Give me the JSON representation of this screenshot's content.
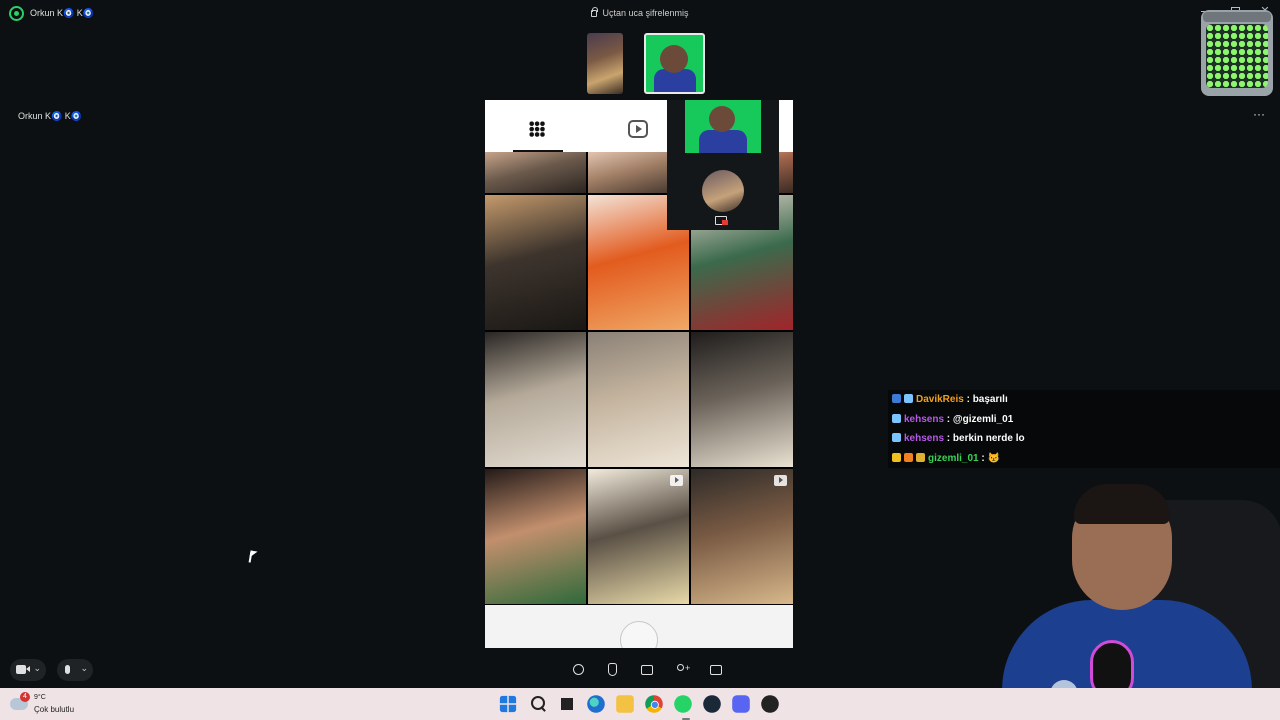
{
  "window": {
    "title": "Orkun K🧿 K🧿",
    "encryption_notice": "Uçtan uca şifrelenmiş",
    "close_glyph": "✕"
  },
  "participant": {
    "label": "Orkun K🧿 K🧿",
    "more_glyph": "···"
  },
  "shared_screen": {
    "app": "instagram-profile-grid",
    "tabs": [
      "grid-icon",
      "reels-icon"
    ],
    "posts": [
      {
        "id": "braids-top",
        "colors": [
          "#2b2420",
          "#6b5a4c",
          "#c7a38a"
        ],
        "reel": false
      },
      {
        "id": "hair-top-2",
        "colors": [
          "#3a2e28",
          "#9f7d64",
          "#e2c4b0"
        ],
        "reel": false
      },
      {
        "id": "hair-top-3",
        "colors": [
          "#3a2b24",
          "#a0644a",
          "#e8c8b0"
        ],
        "reel": false
      },
      {
        "id": "braids-closeup",
        "colors": [
          "#1a1714",
          "#3d342d",
          "#c49a6c"
        ],
        "reel": false
      },
      {
        "id": "copper-hair-smile",
        "colors": [
          "#f0a866",
          "#e25b1e",
          "#f3e3d8"
        ],
        "reel": false
      },
      {
        "id": "red-curls",
        "colors": [
          "#a2242a",
          "#3b6a4c",
          "#e5d5cd"
        ],
        "reel": false
      },
      {
        "id": "blonde-bob-1",
        "colors": [
          "#e4ddd2",
          "#b5aa9a",
          "#2a2624"
        ],
        "reel": false
      },
      {
        "id": "blonde-bob-2",
        "colors": [
          "#efe6d8",
          "#c3b39e",
          "#8a8076"
        ],
        "reel": false
      },
      {
        "id": "blonde-bob-3",
        "colors": [
          "#e9e2d2",
          "#6a6259",
          "#1f1d1c"
        ],
        "reel": false
      },
      {
        "id": "man-selfie",
        "colors": [
          "#2f6a3a",
          "#c28f6d",
          "#241a18"
        ],
        "reel": false
      },
      {
        "id": "hair-extensions",
        "colors": [
          "#e8d9a8",
          "#5a5045",
          "#f2ebdb"
        ],
        "reel": true
      },
      {
        "id": "balayage-waves",
        "colors": [
          "#d7b78a",
          "#7a5b44",
          "#2d2a27"
        ],
        "reel": true
      }
    ]
  },
  "chat": [
    {
      "user": "DavikReis",
      "sep": " : ",
      "message": "başarılı",
      "color": "#f0a020",
      "badges": [
        "#3b7bd6",
        "#7cc4ff"
      ]
    },
    {
      "user": "kehsens",
      "sep": " : ",
      "message": "@gizemli_01",
      "color": "#b45ae6",
      "badges": [
        "#7cc4ff"
      ]
    },
    {
      "user": "kehsens",
      "sep": " : ",
      "message": "berkin nerde lo",
      "color": "#b45ae6",
      "badges": [
        "#7cc4ff"
      ]
    },
    {
      "user": "gizemli_01",
      "sep": " : ",
      "message": "😾",
      "color": "#39d353",
      "badges": [
        "#f0c020",
        "#f08020",
        "#e0b030"
      ]
    }
  ],
  "controls": {
    "video": {
      "icon": "video-camera-icon",
      "chevron": "⌄"
    },
    "mic": {
      "icon": "microphone-icon",
      "chevron": "⌄"
    },
    "center": [
      "emoji-icon",
      "raise-hand-icon",
      "share-screen-icon",
      "add-participant-icon",
      "chat-panel-icon"
    ]
  },
  "taskbar": {
    "weather_badge": "4",
    "temperature": "9°C",
    "weather_desc": "Çok bulutlu",
    "apps": [
      "start-icon",
      "search-icon",
      "task-view-icon",
      "edge-icon",
      "file-explorer-icon",
      "chrome-icon",
      "whatsapp-icon",
      "steam-icon",
      "discord-icon",
      "app-icon"
    ]
  },
  "colors": {
    "background": "#0d1012",
    "whatsapp_green": "#25d366",
    "taskbar": "#f0e3e6",
    "greenscreen": "#17c85a"
  }
}
